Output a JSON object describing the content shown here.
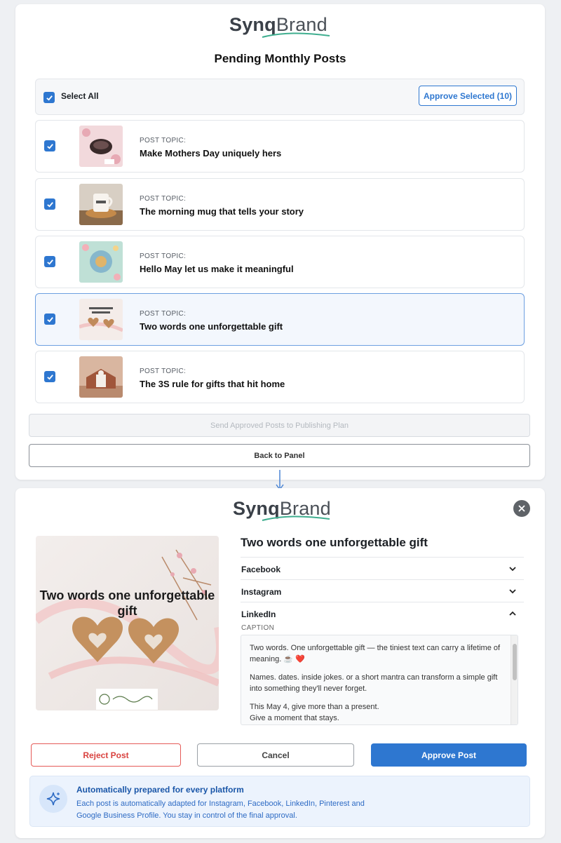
{
  "brand": {
    "part1": "Synq",
    "part2": "Brand"
  },
  "list_panel": {
    "title": "Pending Monthly Posts",
    "select_all_label": "Select All",
    "approve_selected_label": "Approve Selected (10)",
    "posts": [
      {
        "topic_label": "POST TOPIC:",
        "title": "Make Mothers Day uniquely hers",
        "checked": true,
        "selected": false
      },
      {
        "topic_label": "POST TOPIC:",
        "title": "The morning mug that tells your story",
        "checked": true,
        "selected": false
      },
      {
        "topic_label": "POST TOPIC:",
        "title": "Hello May let us make it meaningful",
        "checked": true,
        "selected": false
      },
      {
        "topic_label": "POST TOPIC:",
        "title": "Two words one unforgettable gift",
        "checked": true,
        "selected": true
      },
      {
        "topic_label": "POST TOPIC:",
        "title": "The 3S rule for gifts that hit home",
        "checked": true,
        "selected": false
      }
    ],
    "send_button_label": "Send Approved Posts to Publishing Plan",
    "back_button_label": "Back to Panel"
  },
  "detail_panel": {
    "image_text": "Two words one unforgettable gift",
    "title": "Two words one unforgettable gift",
    "platforms": [
      {
        "name": "Facebook",
        "expanded": false
      },
      {
        "name": "Instagram",
        "expanded": false
      },
      {
        "name": "LinkedIn",
        "expanded": true
      }
    ],
    "caption_label": "CAPTION",
    "caption_paragraphs": [
      "Two words. One unforgettable gift — the tiniest text can carry a lifetime of meaning. ☕ ❤️",
      "Names. dates. inside jokes. or a short mantra can transform a simple gift into something they'll never forget.",
      "This May 4, give more than a present.\nGive a moment that stays."
    ],
    "reject_label": "Reject Post",
    "cancel_label": "Cancel",
    "approve_label": "Approve Post",
    "info_title": "Automatically prepared for every platform",
    "info_text": "Each post is automatically adapted for Instagram, Facebook, LinkedIn, Pinterest and Google Business Profile. You stay in control of the final approval."
  },
  "colors": {
    "accent": "#2e77d0",
    "reject": "#d9423f",
    "info_bg": "#ecf3fd"
  }
}
